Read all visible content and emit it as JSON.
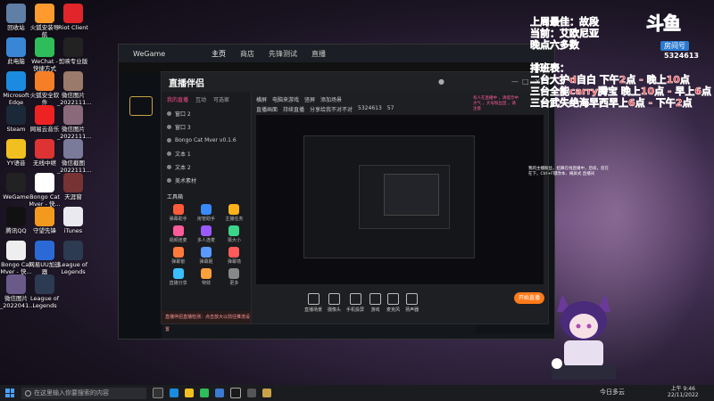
{
  "desktop_icons": [
    {
      "label": "回收站",
      "color": "#5f7fa6"
    },
    {
      "label": "火狐安装导航",
      "color": "#ff9a2e"
    },
    {
      "label": "Riot Client",
      "color": "#e0262a"
    },
    {
      "label": "此电脑",
      "color": "#3a86d6"
    },
    {
      "label": "WeChat - 快捷方式",
      "color": "#2ebd5a"
    },
    {
      "label": "剪映专业版",
      "color": "#222"
    },
    {
      "label": "Microsoft Edge",
      "color": "#1b8be0"
    },
    {
      "label": "火狐安全软件",
      "color": "#f47f27"
    },
    {
      "label": "微信图片_2022111...",
      "color": "#9a7a6a"
    },
    {
      "label": "Steam",
      "color": "#1b2838"
    },
    {
      "label": "网易云音乐",
      "color": "#e22"
    },
    {
      "label": "微信图片_2022111...",
      "color": "#8a6a7a"
    },
    {
      "label": "YY语音",
      "color": "#f0c020"
    },
    {
      "label": "无线中继",
      "color": "#d33"
    },
    {
      "label": "微信截图_2022111...",
      "color": "#7a7a9a"
    },
    {
      "label": "WeGame",
      "color": "#222"
    },
    {
      "label": "Bongo Cat Mver - 快...",
      "color": "#fff"
    },
    {
      "label": "天涯窗",
      "color": "#733"
    },
    {
      "label": "腾讯QQ",
      "color": "#111"
    },
    {
      "label": "守望先锋",
      "color": "#f39a1e"
    },
    {
      "label": "iTunes",
      "color": "#e9e9ef"
    },
    {
      "label": "Bongo Cat Mver - 快...",
      "color": "#eee"
    },
    {
      "label": "网易UU加速器",
      "color": "#2b6ad6"
    },
    {
      "label": "League of Legends",
      "color": "#2c3a52"
    },
    {
      "label": "微信图片_2022041...",
      "color": "#6a5a8a"
    },
    {
      "label": "League of Legends",
      "color": "#2c3a52"
    }
  ],
  "overlay": {
    "line1": "上周最佳：故段",
    "line2": "当前：艾欧尼亚",
    "line3": "晚点六多数",
    "sched_title": "排班表：",
    "sched1": "二台大护d自白 下午2点 - 晚上10点",
    "sched2": "三台全能carry腾宝 晚上10点 - 早上6点",
    "sched3": "三台武失绝海早西早上6点 - 下午2点"
  },
  "logo": {
    "name": "斗鱼",
    "room_label": "房间号",
    "room_id": "5324613"
  },
  "wegame": {
    "brand": "WeGame",
    "tabs": [
      "主页",
      "商店",
      "先锋测试",
      "直播"
    ]
  },
  "app": {
    "title": "直播伴侣",
    "left_tabs": [
      "我的直播",
      "互动",
      "可选家"
    ],
    "sources": [
      "窗口 2",
      "窗口 3",
      "Bongo Cat Mver v0.1.6",
      "文本 1",
      "文本 2",
      "美术素材"
    ],
    "toolbox_title": "工具箱",
    "tools": [
      "弹幕助手",
      "房管助手",
      "主播任务",
      "视频连麦",
      "多人连麦",
      "猜大小",
      "弹幕窗",
      "弹幕姬",
      "弹幕墙",
      "直播分享",
      "特效",
      "更多"
    ],
    "top_row": [
      "横屏",
      "电脑来游戏",
      "竖屏",
      "添加场景"
    ],
    "sec_row": [
      "直播画面",
      "持续直播",
      "分享给我不对不对",
      "5324613",
      "57"
    ],
    "bottom_buttons": [
      "直播场景",
      "摄像头",
      "手机投屏",
      "游戏",
      "麦克风",
      "扬声器"
    ],
    "live_button": "开始直播",
    "bottom_notice": "直播伴侣直播检测：点击放大以前往推流设置"
  },
  "note_pink": "有人在直播中 ，请提示中大气 ，大号粉丝团 ，请注意",
  "note_white": "我的主播粉丝，招募在线直播中，后续，您在在下，Ctrl+F键改本、横屏式 直播间",
  "taskbar": {
    "search_placeholder": "在这里输入你要搜索的内容",
    "weather": "今日多云",
    "time": "上午 9:46",
    "date": "22/11/2022"
  }
}
